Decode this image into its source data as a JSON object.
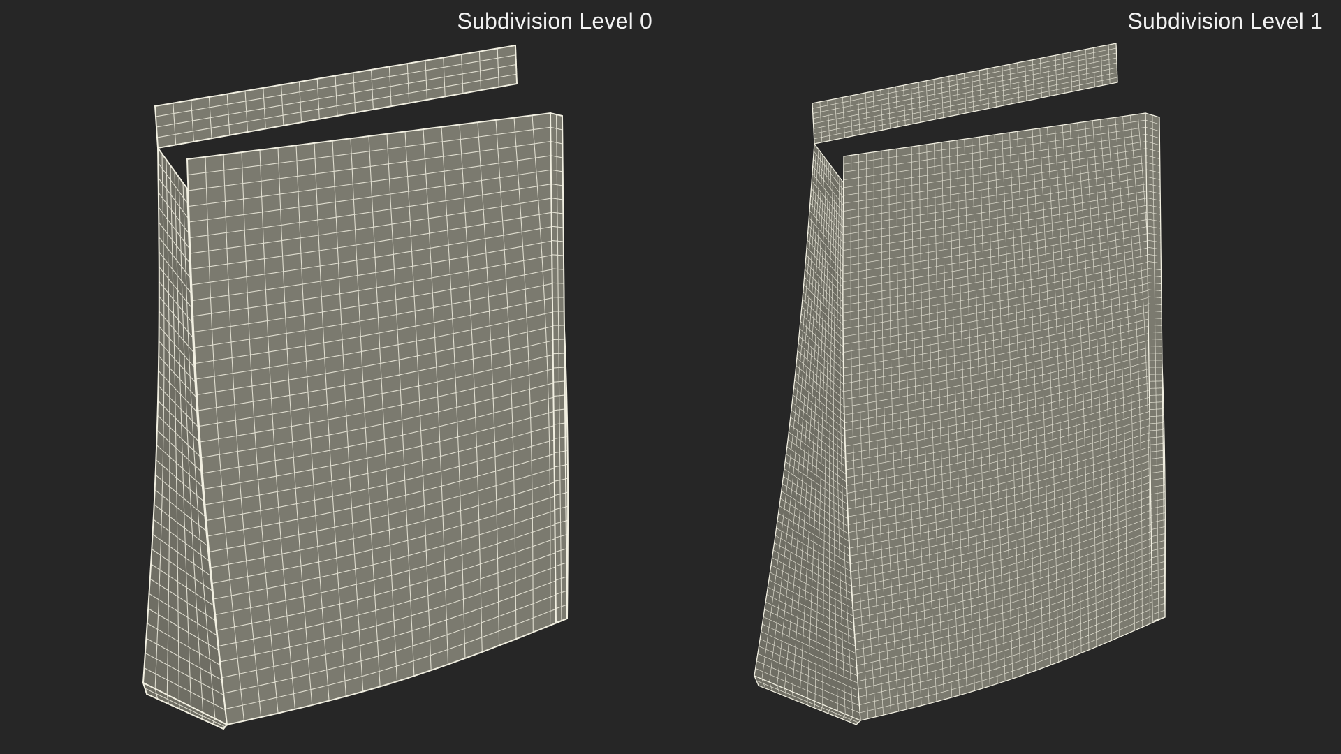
{
  "labels": {
    "left": "Subdivision Level 0",
    "right": "Subdivision Level 1"
  },
  "colors": {
    "background": "#262626",
    "surface_front": "#7b7a6f",
    "surface_side": "#6f6e64",
    "wire": "#f1efe1"
  },
  "models": [
    {
      "name": "pouch-subdivision-0",
      "grid_columns": 20,
      "grid_rows": 36,
      "side_columns": 7
    },
    {
      "name": "pouch-subdivision-1",
      "grid_columns": 40,
      "grid_rows": 72,
      "side_columns": 14
    }
  ]
}
